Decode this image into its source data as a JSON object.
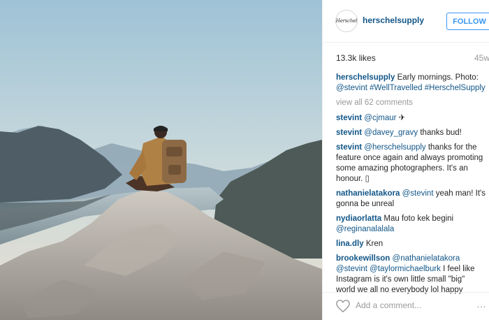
{
  "post": {
    "photo_icon": "landscape-photo",
    "header": {
      "avatar_text": "Herschel",
      "username": "herschelsupply",
      "follow_label": "FOLLOW"
    },
    "stats": {
      "likes": "13.3k likes",
      "time_ago": "45w"
    },
    "caption": {
      "user": "herschelsupply",
      "text_1": " Early mornings. Photo: ",
      "mention": "@stevint",
      "text_2": " ",
      "hashtag_1": "#WellTravelled",
      "text_3": " ",
      "hashtag_2": "#HerschelSupply"
    },
    "view_all": "view all 62 comments",
    "comments": [
      {
        "user": "stevint",
        "mention": "@cjmaur",
        "text": " ✈"
      },
      {
        "user": "stevint",
        "mention": "@davey_gravy",
        "text": " thanks bud!"
      },
      {
        "user": "stevint",
        "mention": "@herschelsupply",
        "text": " thanks for the feature once again and always promoting some amazing photographers. It's an honour. ▯"
      },
      {
        "user": "nathanielatakora",
        "mention": "@stevint",
        "text": " yeah man! It's gonna be unreal"
      },
      {
        "user": "nydiaorlatta",
        "text_before": " Mau foto kek begini ",
        "mention": "@reginanalalala"
      },
      {
        "user": "lina.dly",
        "text": " Kren"
      },
      {
        "user": "brookewillson",
        "mention": "@nathanielatakora",
        "mention_2": "@stevint",
        "mention_3": "@taylormichaelburk",
        "text": " I feel like Instagram is it's own little small \"big\" world we all no everybody lol happy"
      }
    ],
    "footer": {
      "heart_icon": "heart-outline-icon",
      "add_comment_placeholder": "Add a comment...",
      "more_icon": "more-options-icon",
      "more_text": "…"
    },
    "colors": {
      "link": "#125688",
      "follow": "#3897f0",
      "muted": "#999999"
    }
  }
}
